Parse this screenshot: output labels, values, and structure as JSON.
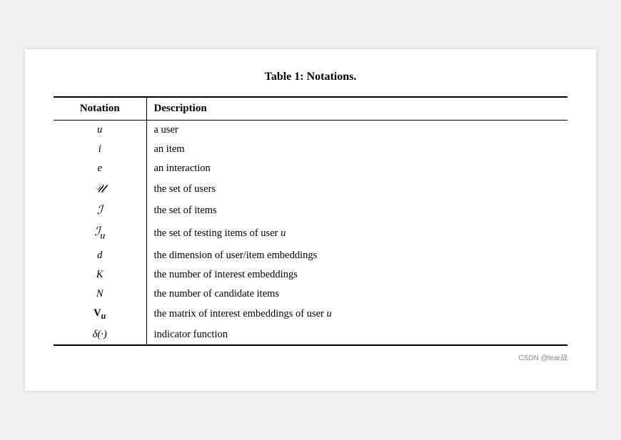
{
  "title": "Table 1:  Notations.",
  "columns": [
    {
      "label": "Notation"
    },
    {
      "label": "Description"
    }
  ],
  "rows": [
    {
      "notation_display": "u",
      "notation_type": "italic",
      "description": "a user"
    },
    {
      "notation_display": "i",
      "notation_type": "italic",
      "description": "an item"
    },
    {
      "notation_display": "e",
      "notation_type": "italic",
      "description": "an interaction"
    },
    {
      "notation_display": "𝒰",
      "notation_type": "script",
      "description": "the set of users"
    },
    {
      "notation_display": "ℐ",
      "notation_type": "script",
      "description": "the set of items"
    },
    {
      "notation_display": "ℐu",
      "notation_type": "script-sub",
      "description": "the set of testing items of user u"
    },
    {
      "notation_display": "d",
      "notation_type": "italic",
      "description": "the dimension of user/item embeddings"
    },
    {
      "notation_display": "K",
      "notation_type": "italic",
      "description": "the number of interest embeddings"
    },
    {
      "notation_display": "N",
      "notation_type": "italic",
      "description": "the number of candidate items"
    },
    {
      "notation_display": "Vu",
      "notation_type": "bold-sub",
      "description": "the matrix of interest embeddings of user u"
    },
    {
      "notation_display": "δ(·)",
      "notation_type": "italic",
      "description": "indicator function"
    }
  ],
  "watermark": "CSDN @tear战"
}
